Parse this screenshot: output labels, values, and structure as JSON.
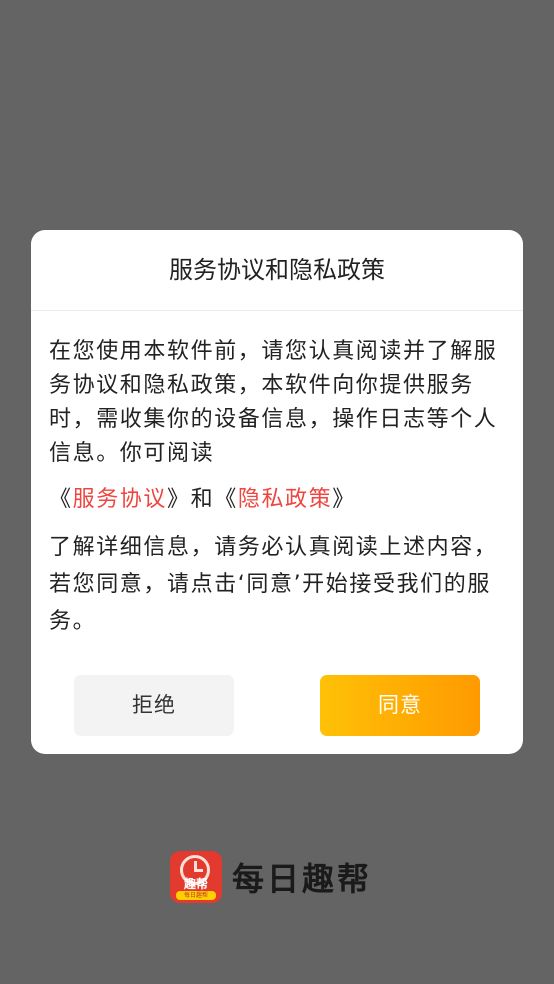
{
  "dialog": {
    "title": "服务协议和隐私政策",
    "paragraph1": "在您使用本软件前，请您认真阅读并了解服务协议和隐私政策，本软件向你提供服务时，需收集你的设备信息，操作日志等个人信息。你可阅读",
    "links": {
      "open1": "《",
      "service_agreement": "服务协议",
      "close1": "》",
      "and": "和",
      "open2": "《",
      "privacy_policy": "隐私政策",
      "close2": "》"
    },
    "paragraph2": "了解详细信息，请务必认真阅读上述内容，若您同意，请点击‘同意’开始接受我们的服务。",
    "reject_label": "拒绝",
    "agree_label": "同意"
  },
  "brand": {
    "logo_text": "趣帮",
    "logo_band": "每日趣帮",
    "name": "每日趣帮"
  },
  "colors": {
    "overlay": "#646464",
    "link": "#f0443f",
    "agree_start": "#ffc107",
    "agree_end": "#ff9a00"
  }
}
